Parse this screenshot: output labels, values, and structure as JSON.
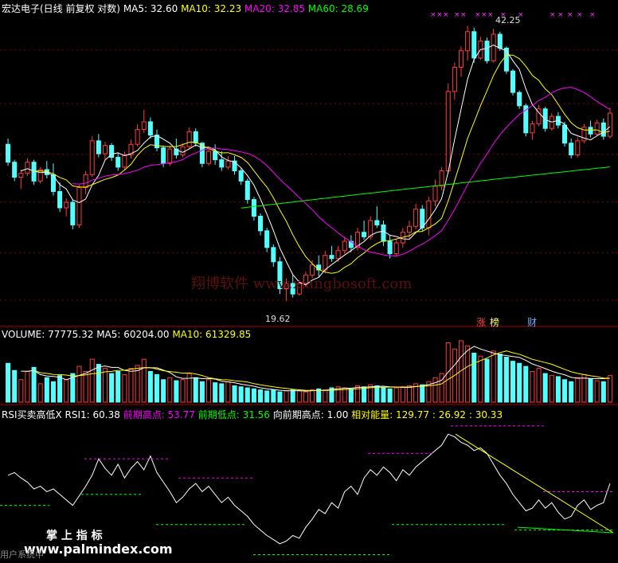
{
  "header": {
    "title": "宏达电子(日线 前复权 对数)",
    "ma": [
      {
        "label": "MA5: 32.60",
        "color": "#ffffff"
      },
      {
        "label": "MA10: 32.23",
        "color": "#ffff00"
      },
      {
        "label": "MA20: 32.85",
        "color": "#ff00ff"
      },
      {
        "label": "MA60: 28.69",
        "color": "#00ff00"
      }
    ]
  },
  "volume_header": [
    {
      "label": "VOLUME: 77775.32",
      "color": "#ffffff"
    },
    {
      "label": "MA5: 60204.00",
      "color": "#ffffff"
    },
    {
      "label": "MA10: 61329.85",
      "color": "#ffff00"
    }
  ],
  "rsi_header": [
    {
      "label": "RSI买卖高低X",
      "color": "#ffffff"
    },
    {
      "label": "RSI1: 60.38",
      "color": "#ffffff"
    },
    {
      "label": "前期高点: 53.77",
      "color": "#ff00ff"
    },
    {
      "label": "前期低点: 31.56",
      "color": "#00ff00"
    },
    {
      "label": "向前期高点: 1.00",
      "color": "#ffffff"
    },
    {
      "label": "相对能量: 129.77",
      "color": "#ffff00"
    },
    {
      "label": ": 26.92",
      "color": "#ffff00"
    },
    {
      "label": ": 30.33",
      "color": "#ffff00"
    }
  ],
  "annotations": {
    "high_label": "42.25",
    "low_label": "19.62"
  },
  "badges": {
    "zhang": "涨",
    "bang": "榜",
    "cai": "财"
  },
  "watermarks": {
    "site": "翔博软件 www.xiangbosoft.com",
    "logo": "掌 上 指 标",
    "bottom": "www.palmindex.com",
    "cut_text": "用户系统中"
  },
  "colors": {
    "up": "#ff3c3c",
    "down": "#54ffff",
    "ma5": "#ffffff",
    "ma10": "#ffff00",
    "ma20": "#ff00ff",
    "ma60": "#00ff00",
    "grid": "#8b0000"
  },
  "chart_data": [
    {
      "type": "candlestick",
      "price_range": [
        19.0,
        44.0
      ],
      "candles_ohlc": [
        [
          30.5,
          31.0,
          28.7,
          29.0
        ],
        [
          29.0,
          29.2,
          27.5,
          27.8
        ],
        [
          27.8,
          28.4,
          26.9,
          28.1
        ],
        [
          28.1,
          29.3,
          27.9,
          29.0
        ],
        [
          29.0,
          29.2,
          27.2,
          27.5
        ],
        [
          27.5,
          28.6,
          27.3,
          28.4
        ],
        [
          28.4,
          29.1,
          27.7,
          28.0
        ],
        [
          28.0,
          28.9,
          26.4,
          26.7
        ],
        [
          26.7,
          27.4,
          25.2,
          25.5
        ],
        [
          25.5,
          26.2,
          24.9,
          25.9
        ],
        [
          25.9,
          26.1,
          24.0,
          24.3
        ],
        [
          24.3,
          27.2,
          24.1,
          27.0
        ],
        [
          27.0,
          28.3,
          26.5,
          28.0
        ],
        [
          28.0,
          31.2,
          27.8,
          30.8
        ],
        [
          30.8,
          31.4,
          29.4,
          29.7
        ],
        [
          29.7,
          30.7,
          29.2,
          30.4
        ],
        [
          30.4,
          30.6,
          29.1,
          29.4
        ],
        [
          29.4,
          29.8,
          28.3,
          28.6
        ],
        [
          28.6,
          29.9,
          28.4,
          29.6
        ],
        [
          29.6,
          30.9,
          29.3,
          30.5
        ],
        [
          30.5,
          32.3,
          30.3,
          31.8
        ],
        [
          31.8,
          33.6,
          31.5,
          32.5
        ],
        [
          32.5,
          32.9,
          31.0,
          31.3
        ],
        [
          31.3,
          31.8,
          29.9,
          30.2
        ],
        [
          30.2,
          30.4,
          28.6,
          28.9
        ],
        [
          28.9,
          30.4,
          28.7,
          30.1
        ],
        [
          30.1,
          31.0,
          29.3,
          29.6
        ],
        [
          29.6,
          30.6,
          29.4,
          30.3
        ],
        [
          30.3,
          32.0,
          30.1,
          31.6
        ],
        [
          31.6,
          31.9,
          30.3,
          30.6
        ],
        [
          30.6,
          30.7,
          28.6,
          28.9
        ],
        [
          28.9,
          30.2,
          28.7,
          29.9
        ],
        [
          29.9,
          30.5,
          28.8,
          29.2
        ],
        [
          29.2,
          29.9,
          28.3,
          28.6
        ],
        [
          28.6,
          29.5,
          28.4,
          29.1
        ],
        [
          29.1,
          29.5,
          28.0,
          28.3
        ],
        [
          28.3,
          28.5,
          27.2,
          27.5
        ],
        [
          27.5,
          27.7,
          25.8,
          26.1
        ],
        [
          26.1,
          26.3,
          24.6,
          24.9
        ],
        [
          24.9,
          25.1,
          23.6,
          23.9
        ],
        [
          23.9,
          24.1,
          22.5,
          22.8
        ],
        [
          22.8,
          23.0,
          21.6,
          21.9
        ],
        [
          21.9,
          22.2,
          20.0,
          20.3
        ],
        [
          20.3,
          20.9,
          19.6,
          20.6
        ],
        [
          20.6,
          21.1,
          19.8,
          20.0
        ],
        [
          20.0,
          20.8,
          19.9,
          20.6
        ],
        [
          20.6,
          21.3,
          20.4,
          21.1
        ],
        [
          21.1,
          22.0,
          20.9,
          21.7
        ],
        [
          21.7,
          22.3,
          21.0,
          21.4
        ],
        [
          21.4,
          22.6,
          21.2,
          22.3
        ],
        [
          22.3,
          22.9,
          21.9,
          22.1
        ],
        [
          22.1,
          22.9,
          21.9,
          22.6
        ],
        [
          22.6,
          23.5,
          22.4,
          23.2
        ],
        [
          23.2,
          23.6,
          22.5,
          22.8
        ],
        [
          22.8,
          24.1,
          22.6,
          23.8
        ],
        [
          23.8,
          24.6,
          23.3,
          23.5
        ],
        [
          23.5,
          24.9,
          23.3,
          24.6
        ],
        [
          24.6,
          25.6,
          24.1,
          24.3
        ],
        [
          24.3,
          24.6,
          22.9,
          23.2
        ],
        [
          23.2,
          23.6,
          22.1,
          22.4
        ],
        [
          22.4,
          23.4,
          22.2,
          23.1
        ],
        [
          23.1,
          24.1,
          22.8,
          23.8
        ],
        [
          23.8,
          24.6,
          23.4,
          24.2
        ],
        [
          24.2,
          25.8,
          24.0,
          25.4
        ],
        [
          25.4,
          25.7,
          23.9,
          24.1
        ],
        [
          24.1,
          26.3,
          23.6,
          26.0
        ],
        [
          26.0,
          27.6,
          25.6,
          27.1
        ],
        [
          27.1,
          28.6,
          26.8,
          28.3
        ],
        [
          28.3,
          36.2,
          28.1,
          35.4
        ],
        [
          35.4,
          38.4,
          34.6,
          37.9
        ],
        [
          37.9,
          40.2,
          36.9,
          39.7
        ],
        [
          39.7,
          42.6,
          38.6,
          41.9
        ],
        [
          41.9,
          42.4,
          38.4,
          38.9
        ],
        [
          38.9,
          41.3,
          38.7,
          40.8
        ],
        [
          40.8,
          41.2,
          38.3,
          38.6
        ],
        [
          38.6,
          42.25,
          38.4,
          41.6
        ],
        [
          41.6,
          41.9,
          39.7,
          40.0
        ],
        [
          40.0,
          40.2,
          37.2,
          37.5
        ],
        [
          37.5,
          37.7,
          35.0,
          35.3
        ],
        [
          35.3,
          35.5,
          33.7,
          34.0
        ],
        [
          34.0,
          34.2,
          31.2,
          31.5
        ],
        [
          31.5,
          32.6,
          30.9,
          32.3
        ],
        [
          32.3,
          34.1,
          32.1,
          33.7
        ],
        [
          33.7,
          33.9,
          31.6,
          31.9
        ],
        [
          31.9,
          33.3,
          31.7,
          33.0
        ],
        [
          33.0,
          33.4,
          31.9,
          32.2
        ],
        [
          32.2,
          32.5,
          30.3,
          30.6
        ],
        [
          30.6,
          31.0,
          29.3,
          29.6
        ],
        [
          29.6,
          31.1,
          29.4,
          30.8
        ],
        [
          30.8,
          32.3,
          30.6,
          32.0
        ],
        [
          32.0,
          32.6,
          31.1,
          31.4
        ],
        [
          31.4,
          32.7,
          31.2,
          32.4
        ],
        [
          32.4,
          32.8,
          30.9,
          31.2
        ],
        [
          31.2,
          33.8,
          31.0,
          33.3
        ]
      ],
      "last_ma": {
        "MA5": 32.6,
        "MA10": 32.23,
        "MA20": 32.85,
        "MA60": 28.69
      }
    },
    {
      "type": "bar",
      "volume": [
        38,
        31,
        22,
        30,
        34,
        18,
        24,
        20,
        26,
        22,
        28,
        35,
        30,
        42,
        37,
        33,
        28,
        30,
        27,
        33,
        36,
        42,
        30,
        27,
        22,
        24,
        21,
        22,
        28,
        24,
        20,
        22,
        19,
        18,
        20,
        16,
        15,
        14,
        13,
        12,
        11,
        12,
        10,
        11,
        12,
        11,
        10,
        12,
        13,
        12,
        14,
        15,
        14,
        13,
        16,
        15,
        17,
        16,
        14,
        13,
        14,
        15,
        16,
        18,
        17,
        20,
        24,
        28,
        58,
        52,
        60,
        55,
        48,
        45,
        42,
        50,
        47,
        44,
        40,
        38,
        35,
        30,
        33,
        28,
        26,
        25,
        22,
        20,
        24,
        27,
        23,
        21,
        20,
        26
      ],
      "last": {
        "VOLUME": 77775.32,
        "MA5": 60204.0,
        "MA10": 61329.85
      }
    },
    {
      "type": "line",
      "rsi": [
        60,
        62,
        58,
        55,
        50,
        52,
        48,
        50,
        46,
        42,
        38,
        45,
        52,
        60,
        72,
        65,
        60,
        68,
        58,
        65,
        70,
        64,
        74,
        62,
        55,
        48,
        40,
        44,
        50,
        54,
        48,
        52,
        46,
        40,
        44,
        38,
        34,
        30,
        24,
        20,
        16,
        13,
        10,
        12,
        16,
        14,
        22,
        28,
        35,
        32,
        40,
        36,
        48,
        52,
        46,
        58,
        64,
        60,
        66,
        62,
        56,
        64,
        60,
        66,
        70,
        74,
        78,
        82,
        90,
        88,
        84,
        82,
        78,
        80,
        76,
        68,
        60,
        54,
        46,
        40,
        34,
        36,
        42,
        36,
        40,
        33,
        28,
        30,
        38,
        42,
        35,
        38,
        40,
        54
      ],
      "range": [
        0,
        100
      ]
    }
  ]
}
